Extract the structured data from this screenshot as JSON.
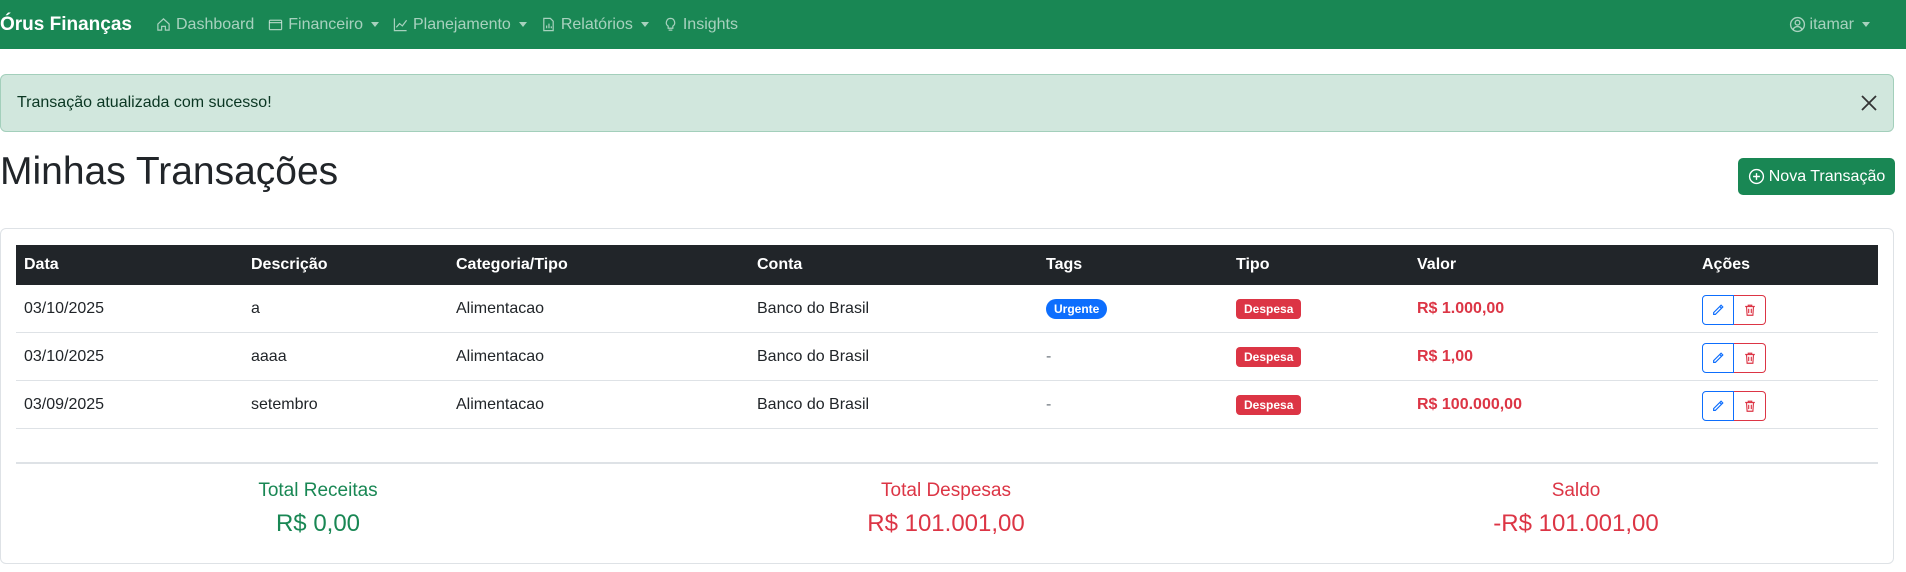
{
  "navbar": {
    "brand": "Órus Finanças",
    "items": [
      {
        "label": "Dashboard",
        "icon": "house-icon"
      },
      {
        "label": "Financeiro",
        "icon": "wallet-icon",
        "dropdown": true
      },
      {
        "label": "Planejamento",
        "icon": "chart-line-icon",
        "dropdown": true
      },
      {
        "label": "Relatórios",
        "icon": "report-icon",
        "dropdown": true
      },
      {
        "label": "Insights",
        "icon": "lightbulb-icon"
      }
    ],
    "user": {
      "label": "itamar",
      "icon": "user-circle-icon",
      "dropdown": true
    }
  },
  "alert": {
    "message": "Transação atualizada com sucesso!",
    "close_icon": "close-icon"
  },
  "page": {
    "title": "Minhas Transações",
    "new_button_label": "Nova Transação",
    "new_button_icon": "plus-circle-icon"
  },
  "table": {
    "headers": [
      "Data",
      "Descrição",
      "Categoria/Tipo",
      "Conta",
      "Tags",
      "Tipo",
      "Valor",
      "Ações"
    ],
    "rows": [
      {
        "data": "03/10/2025",
        "descricao": "a",
        "categoria": "Alimentacao",
        "conta": "Banco do Brasil",
        "tag": "Urgente",
        "tipo": "Despesa",
        "valor": "R$ 1.000,00"
      },
      {
        "data": "03/10/2025",
        "descricao": "aaaa",
        "categoria": "Alimentacao",
        "conta": "Banco do Brasil",
        "tag": "-",
        "tipo": "Despesa",
        "valor": "R$ 1,00"
      },
      {
        "data": "03/09/2025",
        "descricao": "setembro",
        "categoria": "Alimentacao",
        "conta": "Banco do Brasil",
        "tag": "-",
        "tipo": "Despesa",
        "valor": "R$ 100.000,00"
      }
    ]
  },
  "totals": {
    "receitas_label": "Total Receitas",
    "receitas_value": "R$ 0,00",
    "despesas_label": "Total Despesas",
    "despesas_value": "R$ 101.001,00",
    "saldo_label": "Saldo",
    "saldo_value": "-R$ 101.001,00"
  },
  "colors": {
    "primary": "#198754",
    "danger": "#dc3545",
    "info": "#0d6efd",
    "dark": "#212529",
    "alert_bg": "#d1e7dd"
  }
}
